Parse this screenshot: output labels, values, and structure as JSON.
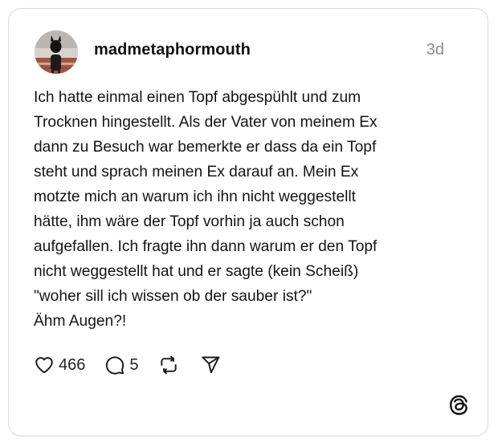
{
  "post": {
    "username": "madmetaphormouth",
    "timestamp": "3d",
    "text_lines": [
      "Ich hatte einmal einen Topf abgespühlt und zum",
      "Trocknen hingestellt. Als der Vater von meinem Ex",
      "dann zu Besuch war bemerkte er dass da ein Topf",
      "steht und sprach meinen Ex darauf an. Mein Ex",
      "motzte mich an warum ich ihn nicht weggestellt",
      "hätte, ihm wäre der Topf vorhin ja auch schon",
      "aufgefallen. Ich fragte ihn dann warum er den Topf",
      "nicht weggestellt hat und er sagte (kein Scheiß)",
      "\"woher sill ich wissen ob der sauber ist?\"",
      "Ähm Augen?!"
    ]
  },
  "actions": {
    "likes": "466",
    "replies": "5"
  },
  "icons": {
    "like": "heart-icon",
    "reply": "speech-bubble-icon",
    "repost": "repost-icon",
    "share": "send-icon",
    "brand": "threads-logo-icon"
  },
  "colors": {
    "text": "#141414",
    "muted": "#8a8a8a",
    "border": "#d9d9d9"
  }
}
